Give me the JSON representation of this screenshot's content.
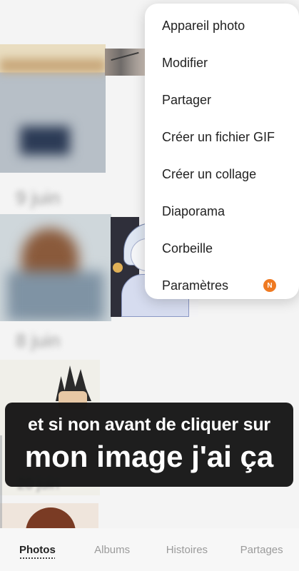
{
  "menu": {
    "items": [
      {
        "label": "Appareil photo"
      },
      {
        "label": "Modifier"
      },
      {
        "label": "Partager"
      },
      {
        "label": "Créer un fichier GIF"
      },
      {
        "label": "Créer un collage"
      },
      {
        "label": "Diaporama"
      },
      {
        "label": "Corbeille"
      },
      {
        "label": "Paramètres",
        "badge": "N"
      }
    ]
  },
  "gallery": {
    "date_labels": [
      "9 juin",
      "8 juin",
      "20 juin"
    ]
  },
  "caption": {
    "line1": "et si non avant de cliquer sur",
    "line2": "mon image j'ai ça"
  },
  "bottom_nav": {
    "tabs": [
      {
        "label": "Photos",
        "active": true
      },
      {
        "label": "Albums"
      },
      {
        "label": "Histoires"
      },
      {
        "label": "Partages"
      }
    ]
  },
  "colors": {
    "badge": "#ef7a22",
    "caption_bg": "#101010"
  }
}
